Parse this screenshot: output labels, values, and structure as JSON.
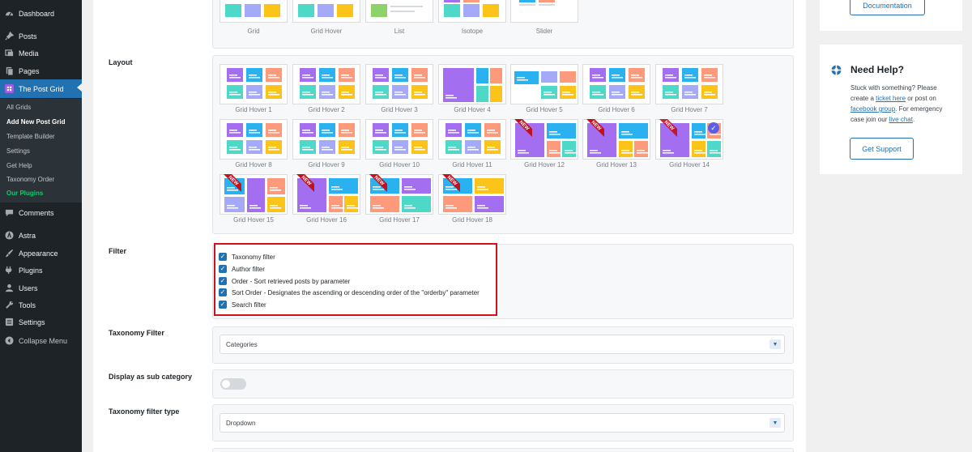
{
  "sidebar": {
    "dashboard": "Dashboard",
    "posts": "Posts",
    "media": "Media",
    "pages": "Pages",
    "post_grid": "The Post Grid",
    "submenu": [
      "All Grids",
      "Add New Post Grid",
      "Template Builder",
      "Settings",
      "Get Help",
      "Taxonomy Order",
      "Our Plugins"
    ],
    "comments": "Comments",
    "astra": "Astra",
    "appearance": "Appearance",
    "plugins": "Plugins",
    "users": "Users",
    "tools": "Tools",
    "settings": "Settings",
    "collapse": "Collapse Menu"
  },
  "top_layouts": [
    "Grid",
    "Grid Hover",
    "List",
    "Isotope",
    "Slider"
  ],
  "layout": {
    "label": "Layout",
    "items": [
      "Grid Hover 1",
      "Grid Hover 2",
      "Grid Hover 3",
      "Grid Hover 4",
      "Grid Hover 5",
      "Grid Hover 6",
      "Grid Hover 7",
      "Grid Hover 8",
      "Grid Hover 9",
      "Grid Hover 10",
      "Grid Hover 11",
      "Grid Hover 12",
      "Grid Hover 13",
      "Grid Hover 14",
      "Grid Hover 15",
      "Grid Hover 16",
      "Grid Hover 17",
      "Grid Hover 18"
    ],
    "new_badge": "NEW",
    "selected": "Grid Hover 14"
  },
  "filter": {
    "label": "Filter",
    "options": [
      "Taxonomy filter",
      "Author filter",
      "Order - Sort retrieved posts by parameter",
      "Sort Order - Designates the ascending or descending order of the \"orderby\" parameter",
      "Search filter"
    ]
  },
  "taxonomy_filter": {
    "label": "Taxonomy Filter",
    "value": "Categories"
  },
  "sub_category": {
    "label": "Display as sub category",
    "enabled": false
  },
  "taxonomy_filter_type": {
    "label": "Taxonomy filter type",
    "value": "Dropdown"
  },
  "right": {
    "documentation": "Documentation",
    "need_help_title": "Need Help?",
    "help_text_1": "Stuck with something? Please create a ",
    "ticket_link": "ticket here",
    "help_text_2": " or post on ",
    "facebook_link": "facebook group",
    "help_text_3": ". For emergency case join our ",
    "live_chat_link": "live chat",
    "help_text_4": ".",
    "get_support": "Get Support"
  },
  "colors": {
    "accent": "#2271b1",
    "sidebar": "#1d2327",
    "active": "#2271b1",
    "highlight_border": "#d0121e",
    "new_badge": "#c0111e"
  }
}
